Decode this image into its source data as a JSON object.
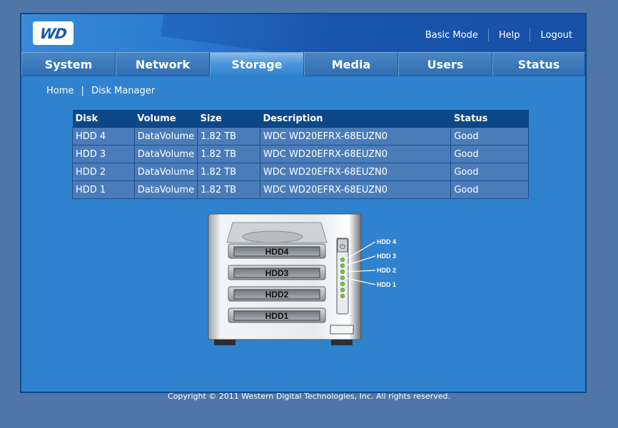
{
  "header": {
    "logo_text": "WD",
    "links": [
      {
        "label": "Basic Mode"
      },
      {
        "label": "Help"
      },
      {
        "label": "Logout"
      }
    ]
  },
  "nav": {
    "tabs": [
      {
        "label": "System",
        "active": false
      },
      {
        "label": "Network",
        "active": false
      },
      {
        "label": "Storage",
        "active": true
      },
      {
        "label": "Media",
        "active": false
      },
      {
        "label": "Users",
        "active": false
      },
      {
        "label": "Status",
        "active": false
      }
    ]
  },
  "breadcrumb": {
    "home": "Home",
    "separator": "|",
    "current": "Disk Manager"
  },
  "disk_table": {
    "columns": [
      "Disk",
      "Volume",
      "Size",
      "Description",
      "Status"
    ],
    "rows": [
      [
        "HDD 4",
        "DataVolume",
        "1.82 TB",
        "WDC WD20EFRX-68EUZN0",
        "Good"
      ],
      [
        "HDD 3",
        "DataVolume",
        "1.82 TB",
        "WDC WD20EFRX-68EUZN0",
        "Good"
      ],
      [
        "HDD 2",
        "DataVolume",
        "1.82 TB",
        "WDC WD20EFRX-68EUZN0",
        "Good"
      ],
      [
        "HDD 1",
        "DataVolume",
        "1.82 TB",
        "WDC WD20EFRX-68EUZN0",
        "Good"
      ]
    ]
  },
  "device_diagram": {
    "bays": [
      "HDD4",
      "HDD3",
      "HDD2",
      "HDD1"
    ],
    "led_labels": [
      "HDD 4",
      "HDD 3",
      "HDD 2",
      "HDD 1"
    ],
    "led_color": "#6fcf2e"
  },
  "footer": {
    "copyright": "Copyright © 2011 Western Digital Technologies, Inc. All rights reserved."
  }
}
